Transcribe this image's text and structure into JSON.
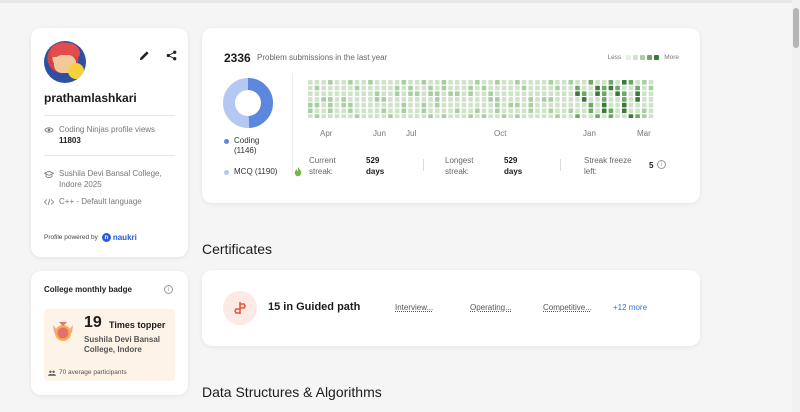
{
  "profile": {
    "username": "prathamlashkari",
    "views_label": "Coding Ninjas profile views",
    "views_count": "11803",
    "college": "Sushila Devi Bansal College, Indore 2025",
    "language": "C++ - Default language",
    "powered_by": "Profile powered by",
    "powered_brand": "naukri"
  },
  "badge": {
    "title": "College monthly badge",
    "count": "19",
    "times_label": "Times topper",
    "college": "Sushila Devi Bansal College, Indore",
    "participants": "70 average participants"
  },
  "submissions": {
    "count": "2336",
    "label": "Problem submissions in the last year",
    "legend_less": "Less",
    "legend_more": "More",
    "legend_colors": [
      "#e6efe3",
      "#cfe3c9",
      "#a7cf9f",
      "#6ea866",
      "#3b7a38"
    ],
    "donut": [
      {
        "label": "Coding",
        "value": "(1146)",
        "color": "#5b87df"
      },
      {
        "label": "MCQ",
        "value": "(1190)",
        "color": "#b5c8f1"
      }
    ],
    "months": [
      "Apr",
      "Jun",
      "Jul",
      "Oct",
      "Jan",
      "Mar"
    ],
    "streaks": {
      "current_label": "Current streak:",
      "current_value": "529 days",
      "longest_label": "Longest streak:",
      "longest_value": "529 days",
      "freeze_label": "Streak freeze left:",
      "freeze_value": "5"
    }
  },
  "sections": {
    "certificates": "Certificates",
    "dsa": "Data Structures & Algorithms"
  },
  "certificates": {
    "title": "15 in Guided path",
    "links": [
      "Interview...",
      "Operating...",
      "Competitive..."
    ],
    "more": "+12 more"
  },
  "colors": {
    "accent": "#3a6fd8",
    "heat_levels": [
      "#e6efe3",
      "#cfe3c9",
      "#a7cf9f",
      "#6ea866",
      "#3b7a38"
    ]
  }
}
